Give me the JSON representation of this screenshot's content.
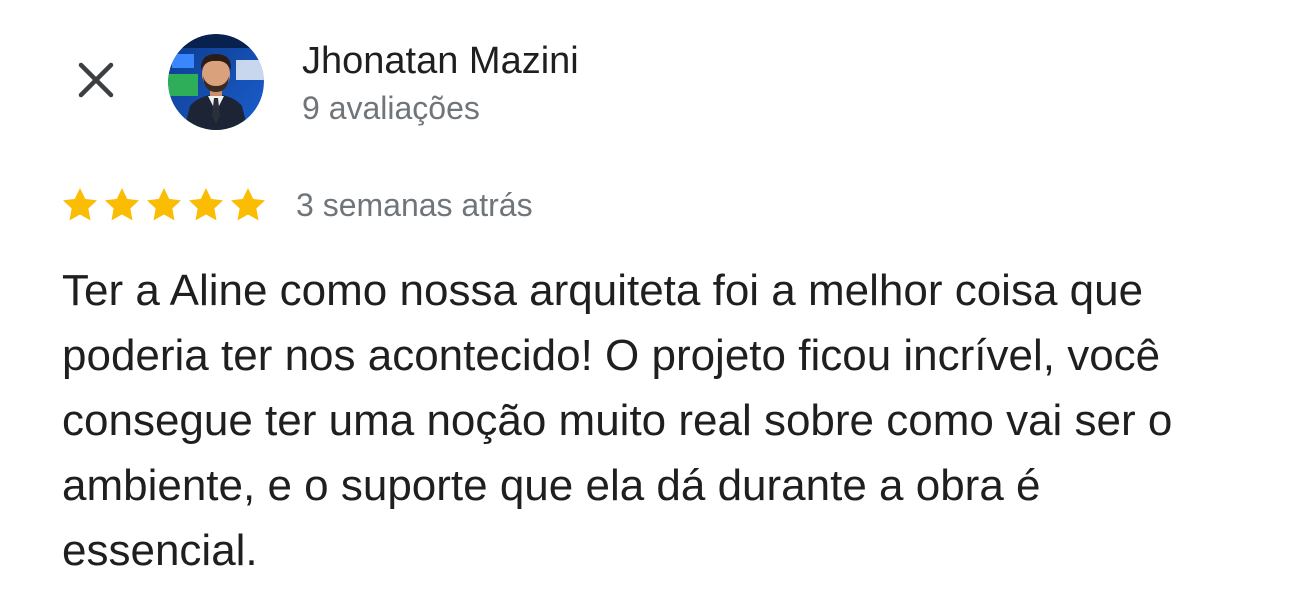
{
  "reviewer": {
    "name": "Jhonatan Mazini",
    "review_count": "9 avaliações"
  },
  "review": {
    "rating": 5,
    "max_rating": 5,
    "date": "3 semanas atrás",
    "text": "Ter a Aline como nossa arquiteta foi a melhor coisa que poderia ter nos acontecido! O projeto ficou incrível, você consegue ter uma noção muito real sobre como vai ser o ambiente, e o suporte que ela dá durante a obra é essencial."
  },
  "icons": {
    "close": "close-icon",
    "star": "star-icon"
  },
  "colors": {
    "star": "#fbbc04",
    "primary_text": "#1f1f1f",
    "secondary_text": "#70757a",
    "background": "#ffffff"
  }
}
